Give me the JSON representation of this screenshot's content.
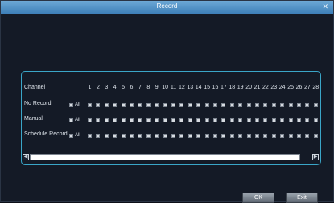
{
  "window": {
    "title": "Record",
    "close_icon": "close-icon"
  },
  "grid": {
    "channel_label": "Channel",
    "channels": [
      "1",
      "2",
      "3",
      "4",
      "5",
      "6",
      "7",
      "8",
      "9",
      "10",
      "11",
      "12",
      "13",
      "14",
      "15",
      "16",
      "17",
      "18",
      "19",
      "20",
      "21",
      "22",
      "23",
      "24",
      "25",
      "26",
      "27",
      "28"
    ],
    "rows": [
      {
        "label": "No Record",
        "all_label": "All"
      },
      {
        "label": "Manual",
        "all_label": "All"
      },
      {
        "label": "Schedule Record",
        "all_label": "All"
      }
    ]
  },
  "scrollbar": {
    "left_icon": "scroll-left-icon",
    "right_icon": "scroll-right-icon"
  },
  "buttons": {
    "ok": "OK",
    "exit": "Exit"
  },
  "colors": {
    "title_bar": "#4f8fc7",
    "panel_border": "#3aa6c8",
    "background": "#141a26"
  }
}
